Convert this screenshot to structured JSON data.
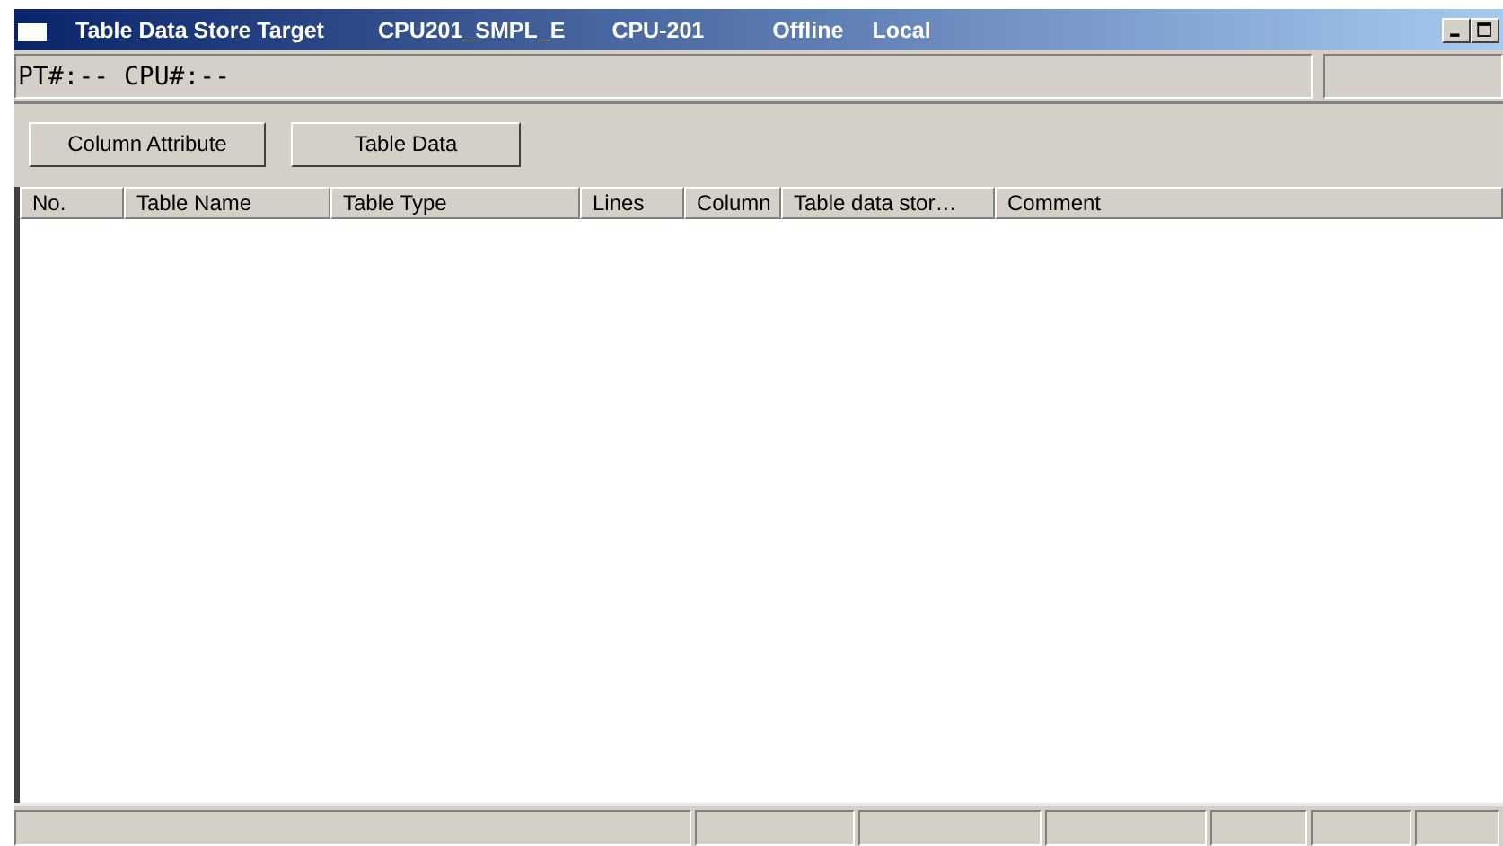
{
  "window": {
    "title_parts": [
      "Table Data Store Target",
      "CPU201_SMPL_E",
      "CPU-201",
      "Offline",
      "Local"
    ]
  },
  "info_bar": {
    "text": "PT#:-- CPU#:--"
  },
  "buttons": [
    "Column Attribute",
    "Table Data"
  ],
  "table": {
    "columns": [
      "No.",
      "Table Name",
      "Table Type",
      "Lines",
      "Column",
      "Table data stor…",
      "Comment"
    ]
  }
}
